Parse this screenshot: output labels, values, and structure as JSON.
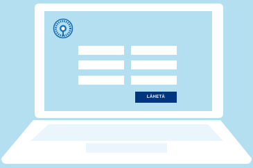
{
  "form": {
    "fields": [
      {
        "value": "",
        "placeholder": ""
      },
      {
        "value": "",
        "placeholder": ""
      },
      {
        "value": "",
        "placeholder": ""
      },
      {
        "value": "",
        "placeholder": ""
      },
      {
        "value": "",
        "placeholder": ""
      },
      {
        "value": "",
        "placeholder": ""
      }
    ],
    "submit_label": "LÄHETÄ"
  },
  "logo": {
    "icon": "university-seal-icon"
  },
  "colors": {
    "background": "#b4dff0",
    "laptop": "#ffffff",
    "button": "#003580",
    "logo": "#1a6fb5"
  }
}
